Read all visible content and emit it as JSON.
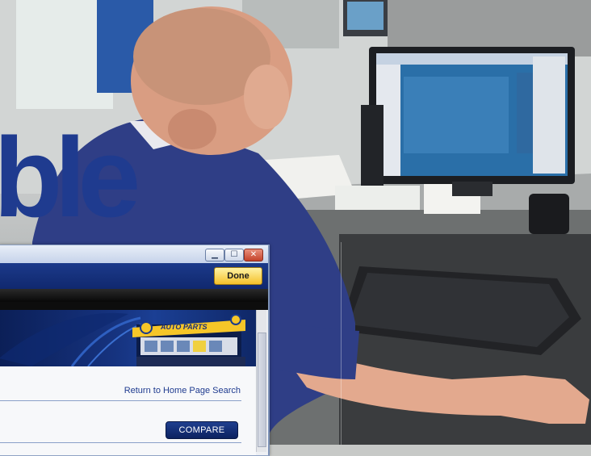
{
  "headline": {
    "text": "ble"
  },
  "window": {
    "title_buttons": {
      "minimize": "▁",
      "maximize": "☐",
      "close": "✕"
    },
    "toolbar": {
      "done_label": "Done"
    },
    "banner": {
      "sign_text": "AUTO PARTS"
    },
    "links": {
      "return_home": "Return to Home Page Search"
    },
    "buttons": {
      "compare": "COMPARE"
    }
  },
  "colors": {
    "brand_blue": "#1f3b8f",
    "done_yellow": "#f4c02a",
    "window_border": "#8fa3c4"
  }
}
